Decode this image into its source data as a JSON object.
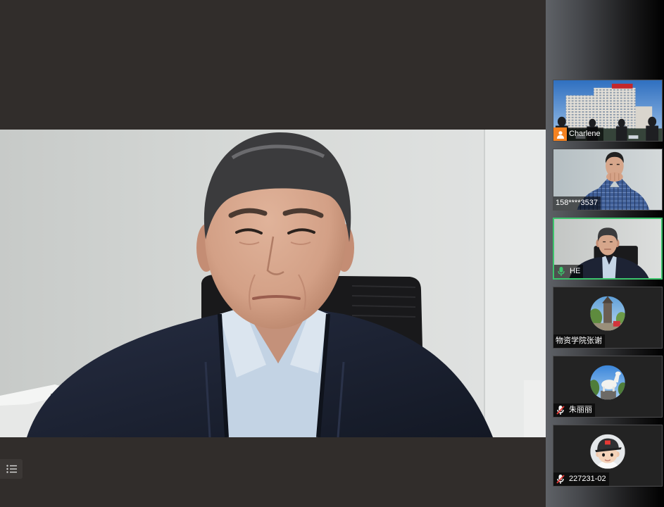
{
  "toolbar": {
    "participant_list_icon": "list-icon"
  },
  "participants": [
    {
      "name": "Charlene",
      "status_icon": "user-avatar-icon",
      "camera_on": true,
      "muted": false,
      "active_speaker": false
    },
    {
      "name": "158****3537",
      "camera_on": true,
      "muted": false,
      "active_speaker": false
    },
    {
      "name": "HE",
      "status_icon": "mic-on-icon",
      "camera_on": true,
      "muted": false,
      "active_speaker": true
    },
    {
      "name": "物资学院张谢",
      "camera_on": false,
      "muted": false,
      "active_speaker": false
    },
    {
      "name": "朱丽丽",
      "status_icon": "mic-muted-icon",
      "camera_on": false,
      "muted": true,
      "active_speaker": false
    },
    {
      "name": "227231-02",
      "status_icon": "mic-muted-icon",
      "camera_on": false,
      "muted": true,
      "active_speaker": false
    }
  ],
  "colors": {
    "active_speaker_border": "#3cc46c",
    "mic_on": "#3cc46c",
    "mic_muted_slash": "#e53935",
    "avatar_icon_bg": "#f58220",
    "stage_background": "#312d2b"
  }
}
